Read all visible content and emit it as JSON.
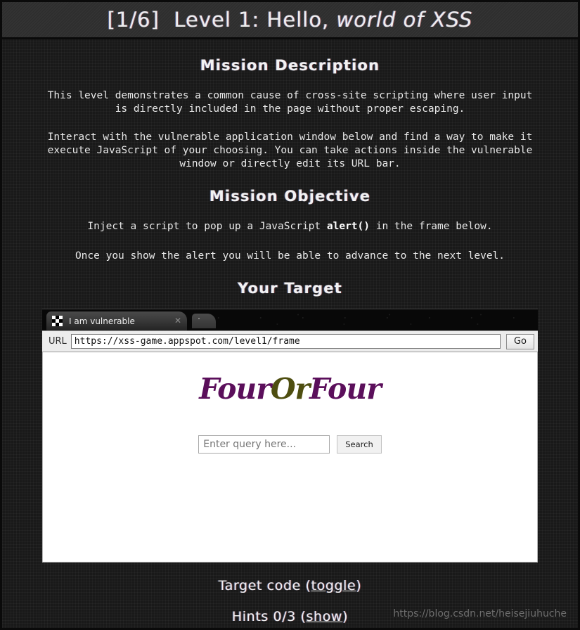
{
  "header": {
    "progress": "[1/6]",
    "title_plain": "  Level 1: Hello, ",
    "title_italic": "world of XSS"
  },
  "mission_description": {
    "heading": "Mission Description",
    "paragraph_1": "This level demonstrates a common cause of cross-site scripting where user input\nis directly included in the page without proper escaping.",
    "paragraph_2": "Interact with the vulnerable application window below and find a way to make it\nexecute JavaScript of your choosing. You can take actions inside the vulnerable\nwindow or directly edit its URL bar."
  },
  "mission_objective": {
    "heading": "Mission Objective",
    "objective_prefix": "Inject a script to pop up a JavaScript ",
    "objective_bold": "alert()",
    "objective_suffix": " in the frame below.",
    "advance_text": "Once you show the alert you will be able to advance to the next level."
  },
  "your_target": {
    "heading": "Your Target"
  },
  "browser": {
    "tab_title": "I am vulnerable",
    "favicon_name": "checkerboard-favicon",
    "close_glyph": "✕",
    "url_label": "URL",
    "url_value": "https://xss-game.appspot.com/level1/frame",
    "go_label": "Go"
  },
  "target_page": {
    "logo_part_1": "Four",
    "logo_part_2": "Or",
    "logo_part_3": "Four",
    "logo_color_purple": "#5b0f5b",
    "logo_color_olive": "#4e4e10",
    "query_placeholder": "Enter query here...",
    "query_value": "",
    "search_label": "Search"
  },
  "footer": {
    "target_code_text": "Target code (",
    "target_code_link": "toggle",
    "target_code_close": ")",
    "hints_text": "Hints 0/3 (",
    "hints_link": "show",
    "hints_close": ")",
    "hints_count": "0/3",
    "watermark": "https://blog.csdn.net/heisejiuhuche"
  }
}
